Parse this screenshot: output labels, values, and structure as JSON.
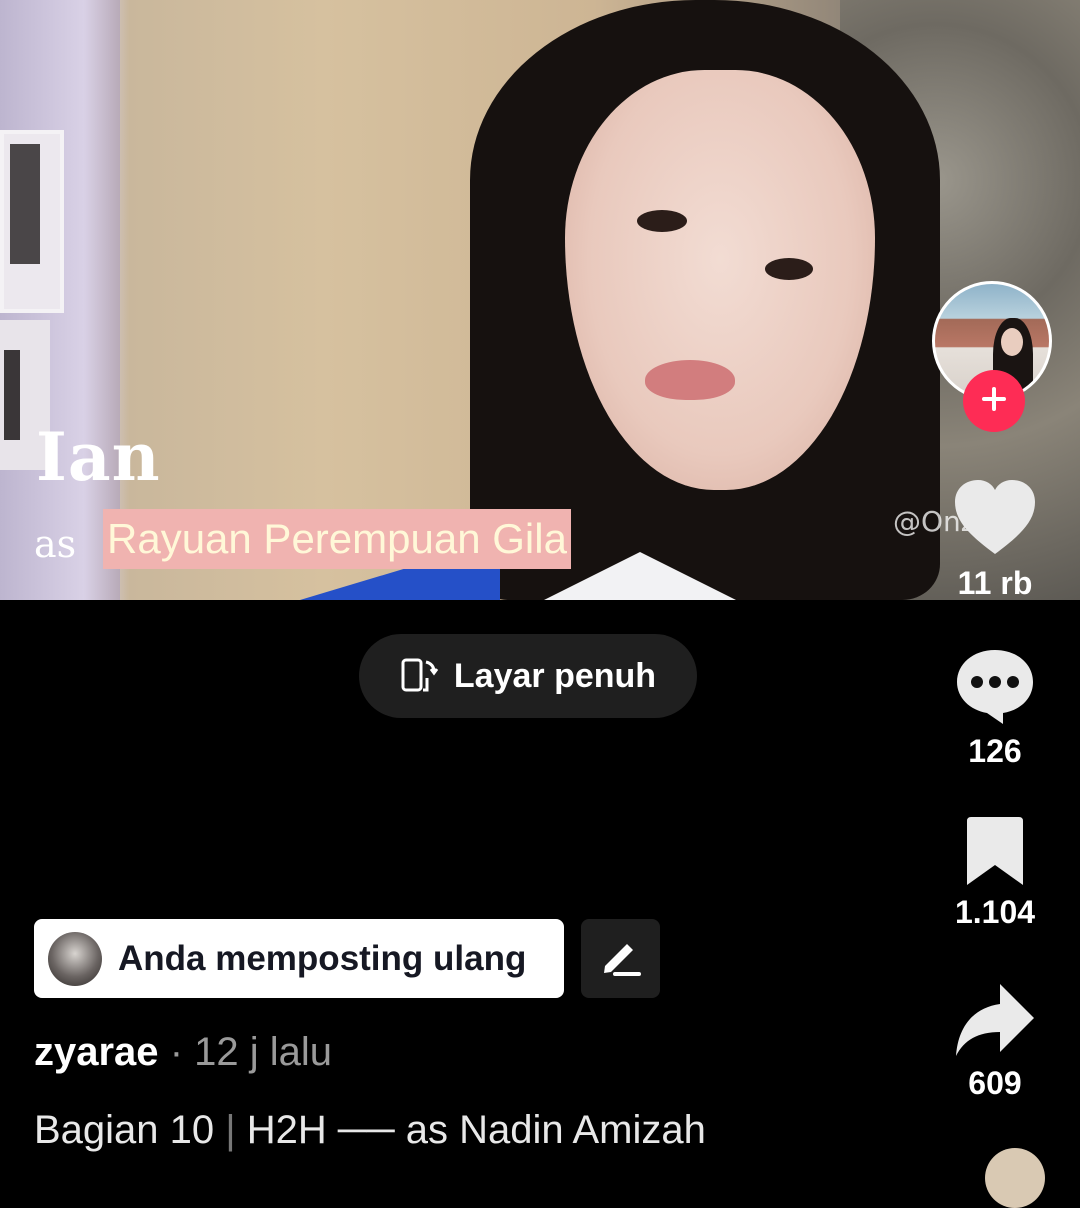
{
  "video": {
    "title_word": "Ian",
    "as_word": "as",
    "song_chip": "Rayuan Perempuan Gila",
    "watermark": "@Onzya"
  },
  "fullscreen_button": {
    "label": "Layar penuh",
    "icon": "fullscreen-rotate-icon"
  },
  "actions": {
    "follow_icon": "plus-icon",
    "like": {
      "icon": "heart-icon",
      "count": "11 rb"
    },
    "comment": {
      "icon": "comment-bubble-icon",
      "count": "126"
    },
    "save": {
      "icon": "bookmark-icon",
      "count": "1.104"
    },
    "share": {
      "icon": "share-arrow-icon",
      "count": "609"
    }
  },
  "repost": {
    "label": "Anda memposting ulang",
    "edit_icon": "pencil-icon"
  },
  "post": {
    "username": "zyarae",
    "separator": "·",
    "time": "12 j lalu",
    "caption_part1": "Bagian 10",
    "caption_pipe": "|",
    "caption_part2": "H2H ── as Nadin Amizah"
  },
  "colors": {
    "follow_red": "#fe2c55",
    "background": "#000000",
    "chip_pink": "#f0b3b0"
  }
}
